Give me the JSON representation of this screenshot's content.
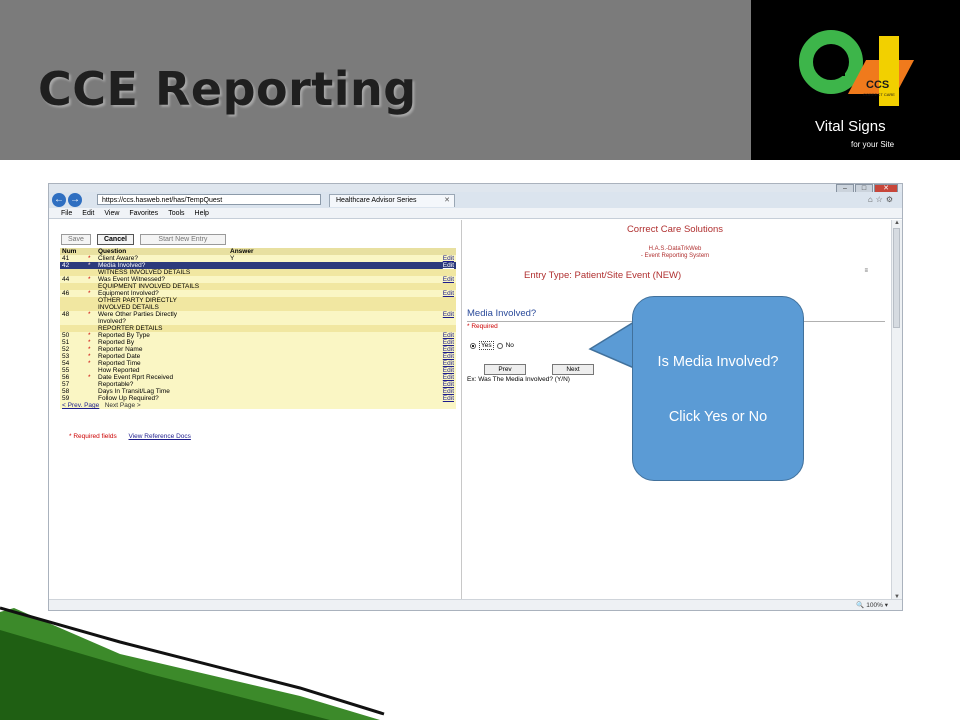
{
  "slide": {
    "title": "CCE Reporting",
    "logo": {
      "brand": "CCS",
      "brand_sub": "CORRECT CARE",
      "tagline": "Vital Signs",
      "subtagline": "for your Site"
    }
  },
  "browser": {
    "url": "https://ccs.hasweb.net/has/TempQuest",
    "tab_title": "Healthcare Advisor Series",
    "window_controls": {
      "minimize": "–",
      "maximize": "□",
      "close": "✕"
    },
    "menu": [
      "File",
      "Edit",
      "View",
      "Favorites",
      "Tools",
      "Help"
    ],
    "zoom": "100%"
  },
  "left_pane": {
    "buttons": {
      "save": "Save",
      "cancel": "Cancel",
      "start_new": "Start New Entry"
    },
    "columns": {
      "num": "Num",
      "question": "Question",
      "answer": "Answer"
    },
    "rows": [
      {
        "num": "41",
        "required": "*",
        "question": "Client Aware?",
        "answer": "Y",
        "edit": "Edit"
      },
      {
        "num": "42",
        "required": "*",
        "question": "Media Involved?",
        "answer": "",
        "edit": "Edit"
      },
      {
        "section": "WITNESS INVOLVED DETAILS"
      },
      {
        "num": "44",
        "required": "*",
        "question": "Was Event Witnessed?",
        "answer": "",
        "edit": "Edit"
      },
      {
        "section": "EQUIPMENT INVOLVED DETAILS"
      },
      {
        "num": "46",
        "required": "*",
        "question": "Equipment Involved?",
        "answer": "",
        "edit": "Edit"
      },
      {
        "section": "OTHER PARTY DIRECTLY"
      },
      {
        "section": "INVOLVED DETAILS"
      },
      {
        "num": "48",
        "required": "*",
        "question": "Were Other Parties Directly",
        "answer": "",
        "edit": "Edit"
      },
      {
        "num": "",
        "required": "",
        "question": "Involved?",
        "answer": "",
        "edit": ""
      },
      {
        "section": "REPORTER DETAILS"
      },
      {
        "num": "50",
        "required": "*",
        "question": "Reported By Type",
        "answer": "",
        "edit": "Edit"
      },
      {
        "num": "51",
        "required": "*",
        "question": "Reported By",
        "answer": "",
        "edit": "Edit"
      },
      {
        "num": "52",
        "required": "*",
        "question": "Reporter Name",
        "answer": "",
        "edit": "Edit"
      },
      {
        "num": "53",
        "required": "*",
        "question": "Reported Date",
        "answer": "",
        "edit": "Edit"
      },
      {
        "num": "54",
        "required": "*",
        "question": "Reported Time",
        "answer": "",
        "edit": "Edit"
      },
      {
        "num": "55",
        "required": "",
        "question": "How Reported",
        "answer": "",
        "edit": "Edit"
      },
      {
        "num": "56",
        "required": "*",
        "question": "Date Event Rprt Received",
        "answer": "",
        "edit": "Edit"
      },
      {
        "num": "57",
        "required": "",
        "question": "Reportable?",
        "answer": "",
        "edit": "Edit"
      },
      {
        "num": "58",
        "required": "",
        "question": "Days In Transit/Lag Time",
        "answer": "",
        "edit": "Edit"
      },
      {
        "num": "59",
        "required": "",
        "question": "Follow Up Required?",
        "answer": "",
        "edit": "Edit"
      }
    ],
    "pager": {
      "prev": "< Prev. Page",
      "next": "Next Page >"
    },
    "required_note": "* Required fields",
    "view_docs": "View Reference Docs"
  },
  "right_pane": {
    "org": "Correct Care Solutions",
    "system_line1": "H.A.S.-DataTrkWeb",
    "system_line2": "- Event Reporting System",
    "entry_type": "Entry Type: Patient/Site Event (NEW)",
    "question": "Media Involved?",
    "required": "* Required",
    "options": {
      "yes": "Yes",
      "no": "No",
      "selected": "Yes"
    },
    "prev": "Prev",
    "next": "Next",
    "example": "Ex: Was The Media Involved? (Y/N)"
  },
  "callout": {
    "line1": "Is Media Involved?",
    "line2": "Click Yes or No"
  },
  "colors": {
    "callout": "#5b9bd5",
    "header": "#7b7b7b",
    "green": "#2f7d1e"
  }
}
